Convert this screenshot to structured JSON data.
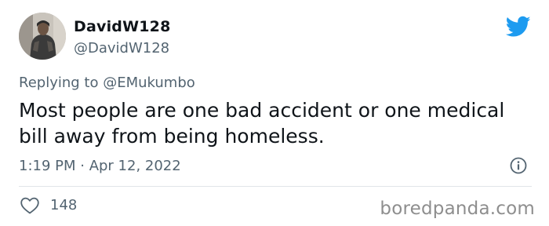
{
  "author": {
    "display_name": "DavidW128",
    "handle": "@DavidW128"
  },
  "reply": {
    "prefix": "Replying to ",
    "mention": "@EMukumbo"
  },
  "tweet": {
    "text": "Most people are one bad accident or one medical bill away from being homeless.",
    "timestamp": "1:19 PM · Apr 12, 2022"
  },
  "engagement": {
    "like_count": "148"
  },
  "watermark": "boredpanda.com",
  "icons": {
    "brand": "twitter-bird-icon",
    "info": "info-icon",
    "like": "heart-icon"
  },
  "colors": {
    "brand_blue": "#1d9bf0",
    "secondary_text": "#536471",
    "primary_text": "#0f1419",
    "divider": "#e1e5e9"
  }
}
